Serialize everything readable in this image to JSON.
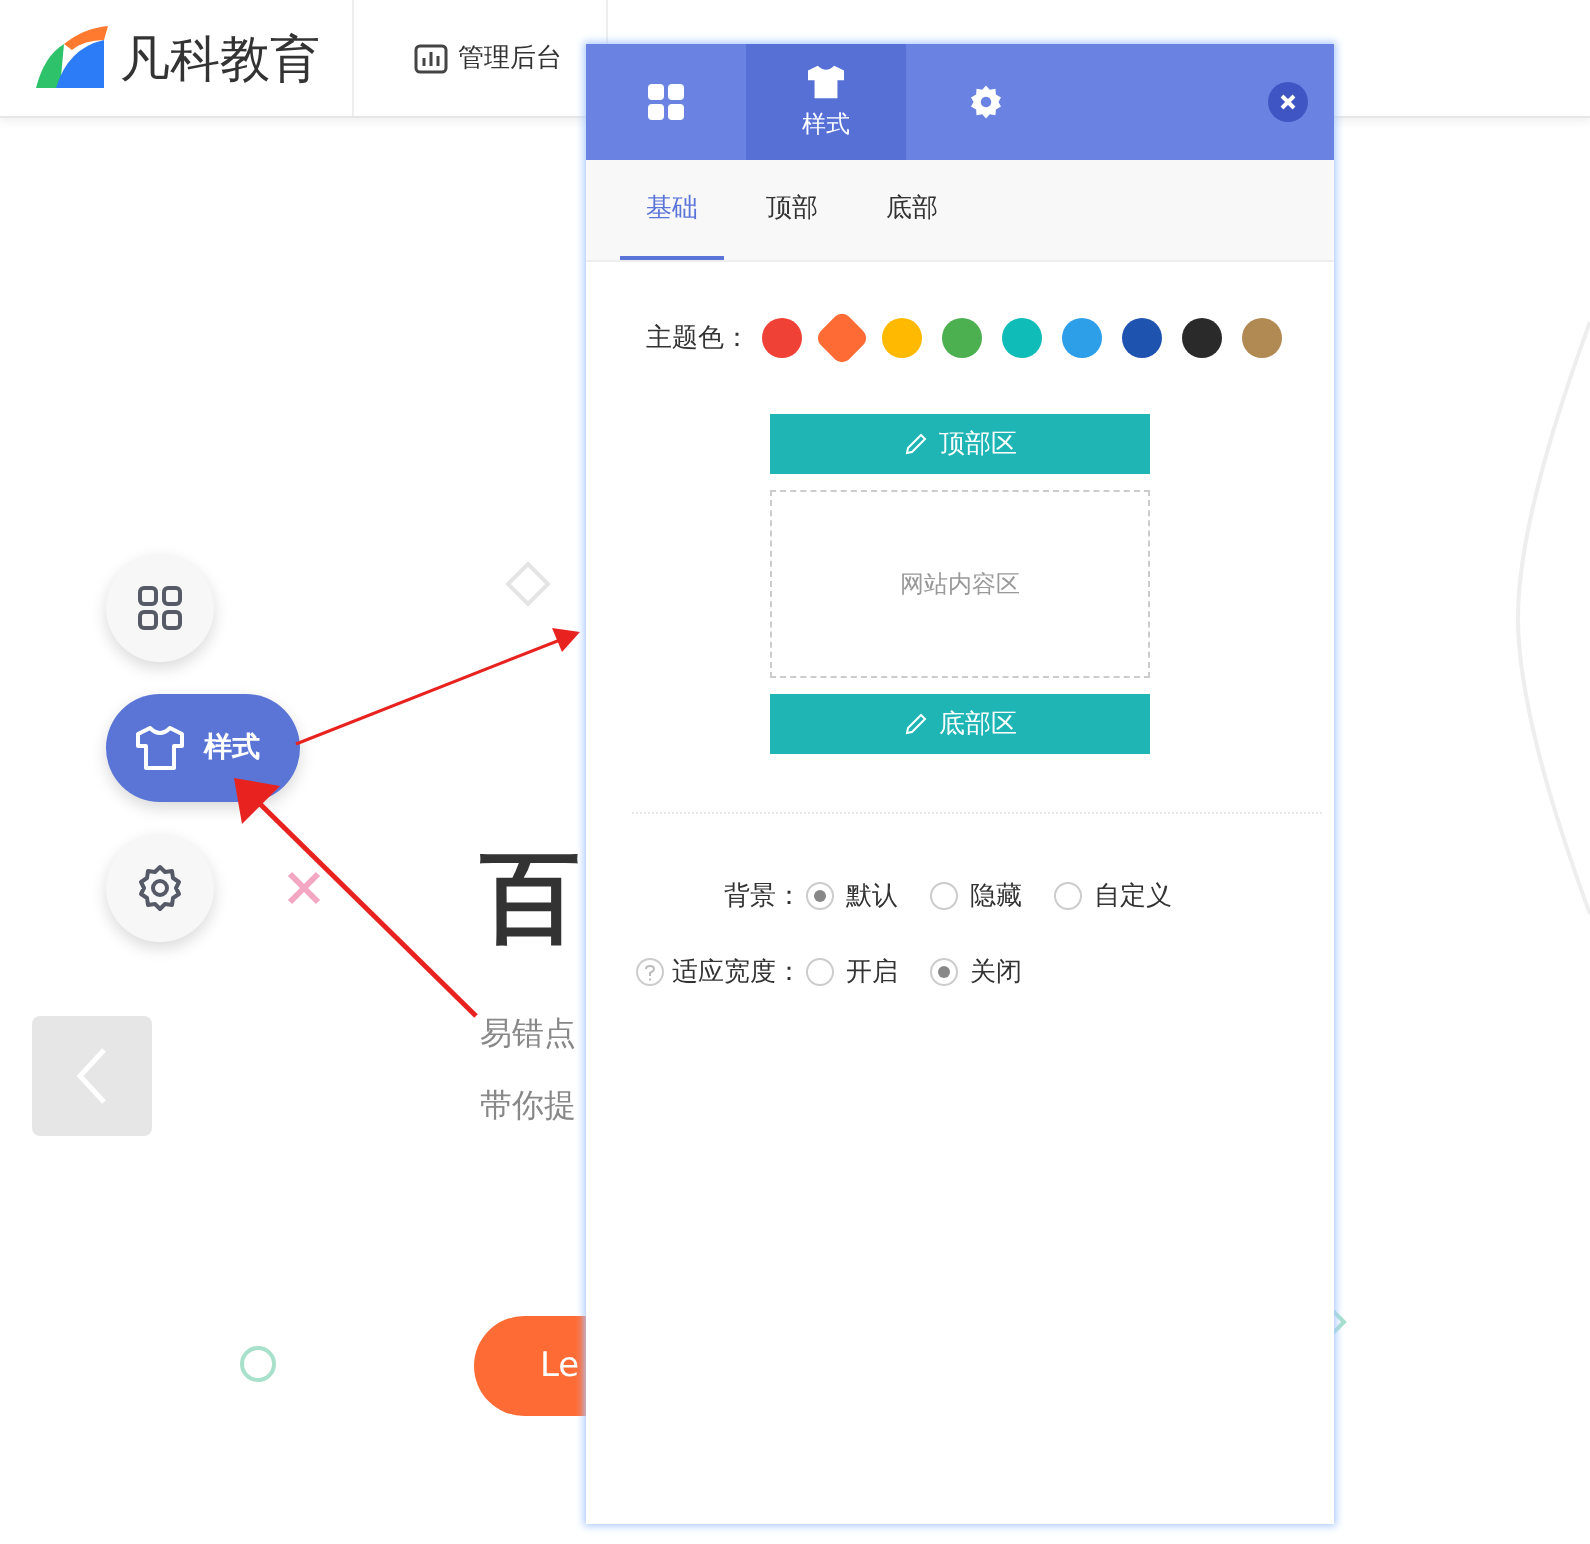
{
  "header": {
    "logo_text": "凡科教育",
    "nav": [
      {
        "label": "管理后台"
      }
    ]
  },
  "hero": {
    "title": "百",
    "lines": [
      "易错点",
      "带你提"
    ],
    "button": "Le"
  },
  "float_toolbar": [
    {
      "kind": "grid",
      "selected": false
    },
    {
      "kind": "shirt",
      "label": "样式",
      "selected": true
    },
    {
      "kind": "gear",
      "selected": false
    }
  ],
  "panel": {
    "tabs": [
      {
        "kind": "grid",
        "selected": false
      },
      {
        "kind": "shirt",
        "label": "样式",
        "selected": true
      },
      {
        "kind": "gear",
        "selected": false
      }
    ],
    "subtabs": [
      {
        "label": "基础",
        "selected": true
      },
      {
        "label": "顶部",
        "selected": false
      },
      {
        "label": "底部",
        "selected": false
      }
    ],
    "theme": {
      "label": "主题色：",
      "colors": [
        {
          "color": "#ef4136",
          "selected": false
        },
        {
          "color": "#ff6b35",
          "selected": true
        },
        {
          "color": "#ffba00",
          "selected": false
        },
        {
          "color": "#4caf50",
          "selected": false
        },
        {
          "color": "#10bcb8",
          "selected": false
        },
        {
          "color": "#2d9fe8",
          "selected": false
        },
        {
          "color": "#1e53b0",
          "selected": false
        },
        {
          "color": "#2a2a2a",
          "selected": false
        },
        {
          "color": "#b08a52",
          "selected": false
        }
      ]
    },
    "preview": {
      "top": "顶部区",
      "content": "网站内容区",
      "bottom": "底部区"
    },
    "options": [
      {
        "label": "背景：",
        "help": false,
        "choices": [
          {
            "label": "默认",
            "selected": true
          },
          {
            "label": "隐藏",
            "selected": false
          },
          {
            "label": "自定义",
            "selected": false
          }
        ]
      },
      {
        "label": "适应宽度：",
        "help": true,
        "choices": [
          {
            "label": "开启",
            "selected": false
          },
          {
            "label": "关闭",
            "selected": true
          }
        ]
      }
    ]
  }
}
